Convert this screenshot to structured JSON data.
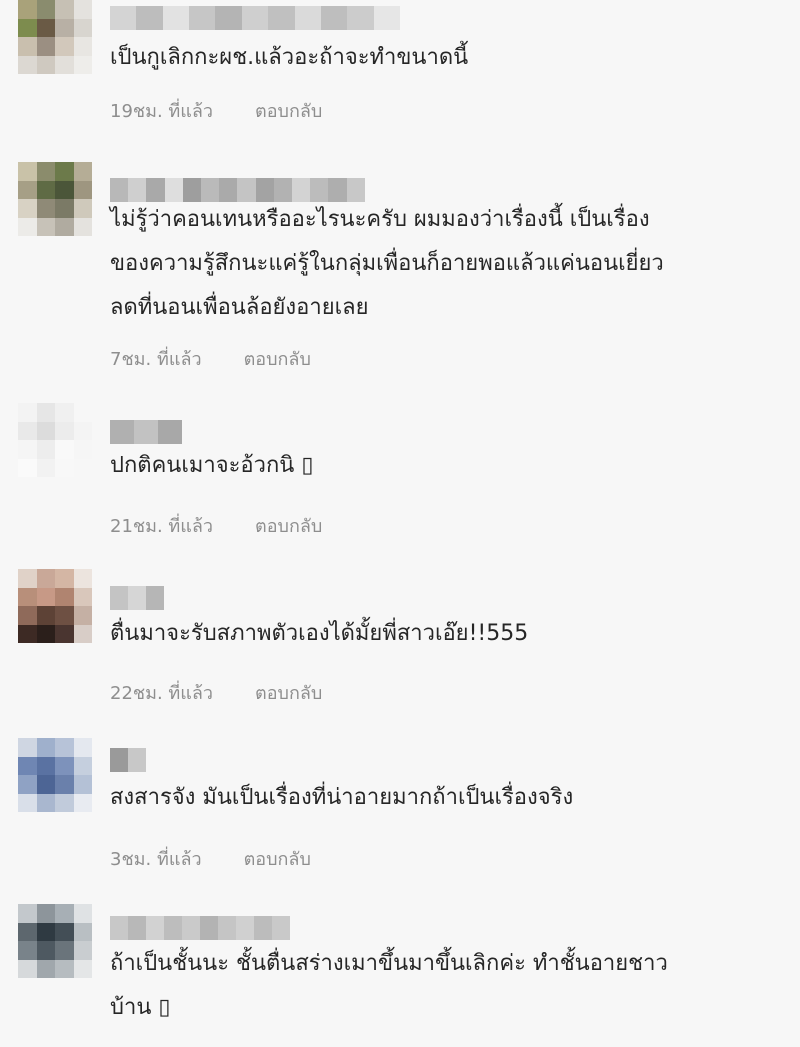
{
  "comments": [
    {
      "avatar_colors": [
        "#a9a27a",
        "#8a8c6e",
        "#c6c0b4",
        "#e4e2de",
        "#7d8c4e",
        "#6a5a45",
        "#b8b0a5",
        "#d8d5cf",
        "#c9bfae",
        "#9b8f82",
        "#d2c8bb",
        "#e8e6e2",
        "#dcd8d2",
        "#cfc9c0",
        "#e2dfda",
        "#eeedea"
      ],
      "name_colors": [
        "#d4d4d4",
        "#bdbdbd",
        "#e2e2e2",
        "#c6c6c6",
        "#b4b4b4",
        "#cfcfcf",
        "#c0c0c0",
        "#dadada",
        "#bebebe",
        "#cccccc",
        "#e6e6e6"
      ],
      "text": "เป็นกูเลิกกะผช.แล้วอะถ้าจะทำขนาดนี้",
      "time": "19ชม. ที่แล้ว",
      "reply": "ตอบกลับ"
    },
    {
      "avatar_colors": [
        "#c9c2a8",
        "#8b8c6c",
        "#6c7a4a",
        "#b5ad96",
        "#a69f86",
        "#5f6b45",
        "#4b5639",
        "#9e9680",
        "#d8d2c4",
        "#8f8a77",
        "#7b7a66",
        "#cfc9bb",
        "#ecebe8",
        "#c7c2b8",
        "#b0aba0",
        "#e4e2de"
      ],
      "name_colors": [
        "#b8b8b8",
        "#cfcfcf",
        "#a9a9a9",
        "#dedede",
        "#9e9e9e",
        "#bababa",
        "#aaaaaa",
        "#c4c4c4",
        "#a3a3a3",
        "#b2b2b2",
        "#d3d3d3",
        "#bcbcbc",
        "#aeaeae",
        "#c8c8c8"
      ],
      "text": "ไม่รู้ว่าคอนเทนหรืออะไรนะครับ ผมมองว่าเรื่องนี้ เป็นเรื่อง\nของความรู้สึกนะแค่รู้ในกลุ่มเพื่อนก็อายพอแล้วแค่นอนเยี่ยว\nลดที่นอนเพื่อนล้อยังอายเลย",
      "time": "7ชม. ที่แล้ว",
      "reply": "ตอบกลับ"
    },
    {
      "avatar_colors": [
        "#f3f3f3",
        "#e6e6e6",
        "#f0f0f0",
        "#f7f7f7",
        "#e9e9e9",
        "#dcdcdc",
        "#ececec",
        "#f4f4f4",
        "#f5f5f5",
        "#ededed",
        "#f9f9f9",
        "#f6f6f6",
        "#fafafa",
        "#f2f2f2",
        "#f8f8f8",
        "#f7f7f7"
      ],
      "name_colors": [
        "#b0b0b0",
        "#c2c2c2",
        "#a8a8a8"
      ],
      "text": "ปกติคนเมาจะอ้วกนิ ▯",
      "time": "21ชม. ที่แล้ว",
      "reply": "ตอบกลับ"
    },
    {
      "avatar_colors": [
        "#e0d2c8",
        "#c9a898",
        "#d4b6a4",
        "#ece4de",
        "#b88f7a",
        "#c79986",
        "#b08470",
        "#d9c7bb",
        "#8f6a5a",
        "#5d4236",
        "#6e5043",
        "#c5b0a4",
        "#3d2a24",
        "#2b1f1b",
        "#4a3530",
        "#d8cdc7"
      ],
      "name_colors": [
        "#c4c4c4",
        "#d6d6d6",
        "#b6b6b6"
      ],
      "text": "ตื่นมาจะรับสภาพตัวเองได้มั้ยพี่สาวเอ๊ย!!555",
      "time": "22ชม. ที่แล้ว",
      "reply": "ตอบกลับ"
    },
    {
      "avatar_colors": [
        "#cfd6e2",
        "#9fb0cc",
        "#b7c3d8",
        "#e4e8ef",
        "#6f86b3",
        "#5a72a2",
        "#7d92bb",
        "#c5cfde",
        "#8fa2c4",
        "#4d6595",
        "#6a80ab",
        "#b4c1d6",
        "#d9dfe9",
        "#a9b7cf",
        "#c1cbdb",
        "#e8ebf1"
      ],
      "name_colors": [
        "#9a9a9a",
        "#c8c8c8"
      ],
      "text": "สงสารจัง มันเป็นเรื่องที่น่าอายมากถ้าเป็นเรื่องจริง",
      "time": "3ชม. ที่แล้ว",
      "reply": "ตอบกลับ"
    },
    {
      "avatar_colors": [
        "#c3c8cc",
        "#8d959b",
        "#a7afb5",
        "#dfe2e4",
        "#5d676e",
        "#2f3a42",
        "#434e56",
        "#b9bfc3",
        "#79838a",
        "#4e5961",
        "#6a747b",
        "#c9cdd0",
        "#d6d9db",
        "#a0a7ac",
        "#b6bcc0",
        "#e4e6e7"
      ],
      "name_colors": [
        "#c8c8c8",
        "#b8b8b8",
        "#d2d2d2",
        "#bdbdbd",
        "#cacaca",
        "#b3b3b3",
        "#c5c5c5",
        "#d0d0d0",
        "#bcbcbc",
        "#c9c9c9"
      ],
      "text": "ถ้าเป็นชั้นนะ ชั้นตื่นสร่างเมาขึ้นมาขึ้นเลิกค่ะ ทำชั้นอายชาว\nบ้าน ▯",
      "time": "",
      "reply": ""
    }
  ]
}
